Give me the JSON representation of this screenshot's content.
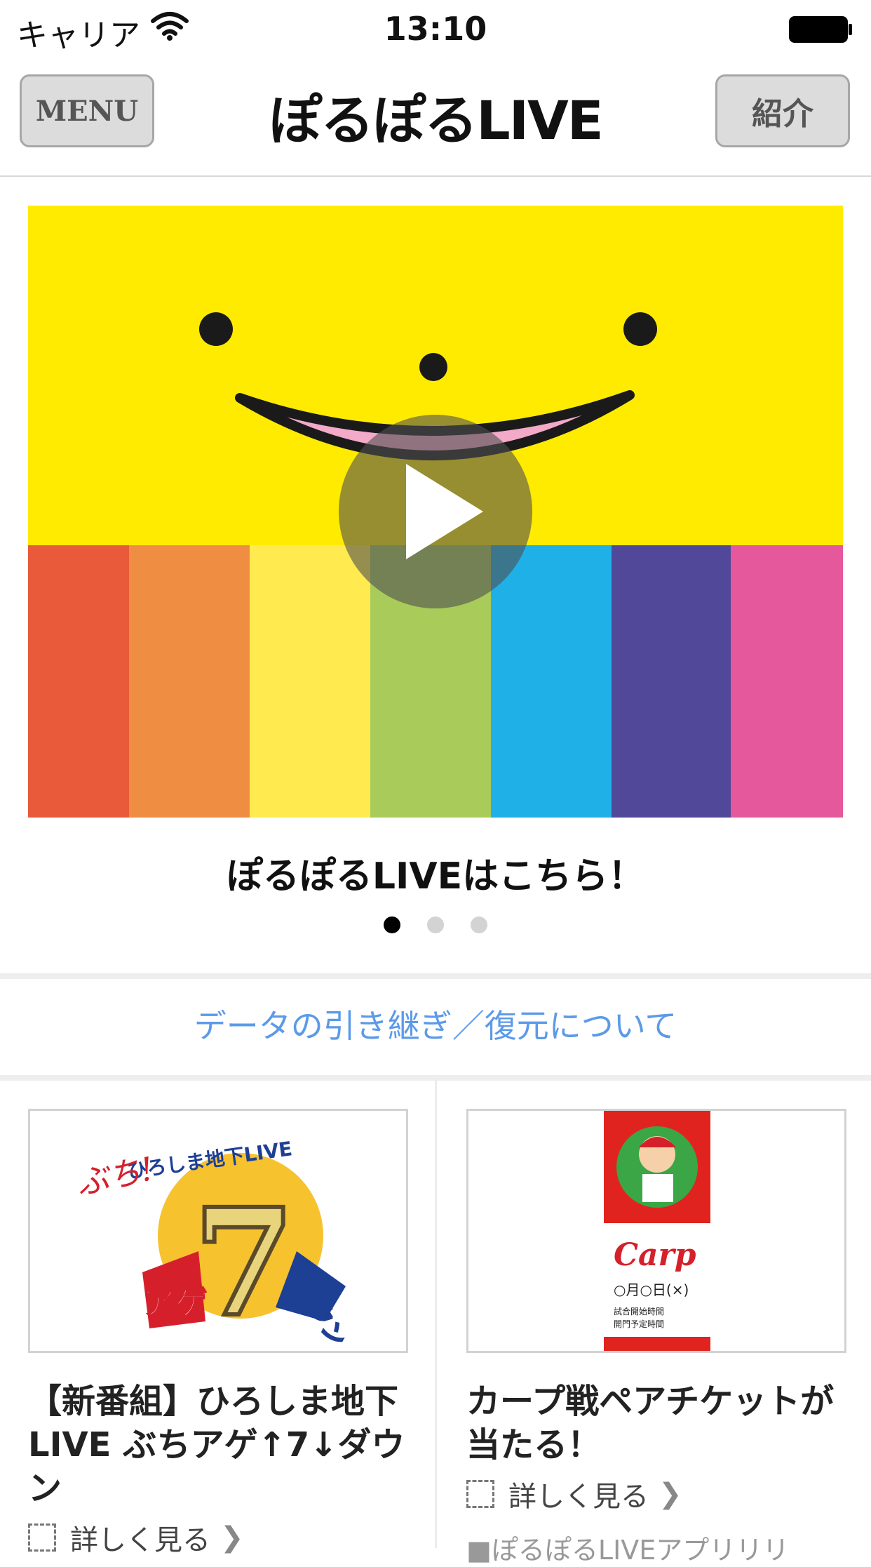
{
  "status_bar": {
    "carrier": "キャリア",
    "time": "13:10"
  },
  "nav": {
    "menu_label": "MENU",
    "logo": "ぽるぽるLIVE",
    "intro_label": "紹介"
  },
  "banner": {
    "caption": "ぽるぽるLIVEはこちら！",
    "page_count": 3,
    "active_page": 1,
    "stripe_colors": [
      "#e85a3a",
      "#ef8e43",
      "#ffea4f",
      "#a8cb5a",
      "#1fb0e8",
      "#514899",
      "#e5599c"
    ],
    "face_color": "#ffeb00"
  },
  "data_link": "データの引き継ぎ／復元について",
  "cards": [
    {
      "title": "【新番組】ひろしま地下LIVE ぶちアゲ↑7↓ダウン",
      "detail": "詳しく見る",
      "image_text": {
        "top": "ひろしま地下LIVE",
        "buchi": "ぶち!",
        "age": "アゲ",
        "down": "ダウン",
        "seven": "7"
      }
    },
    {
      "title": "カープ戦ペアチケットが当たる！",
      "detail": "詳しく見る",
      "image_text": {
        "brand": "Carp",
        "date": "○月○日(×)",
        "line1": "試合開始時間",
        "line2": "開門予定時間"
      }
    }
  ],
  "footnote": "■ぽるぽるLIVEアプリリリ"
}
